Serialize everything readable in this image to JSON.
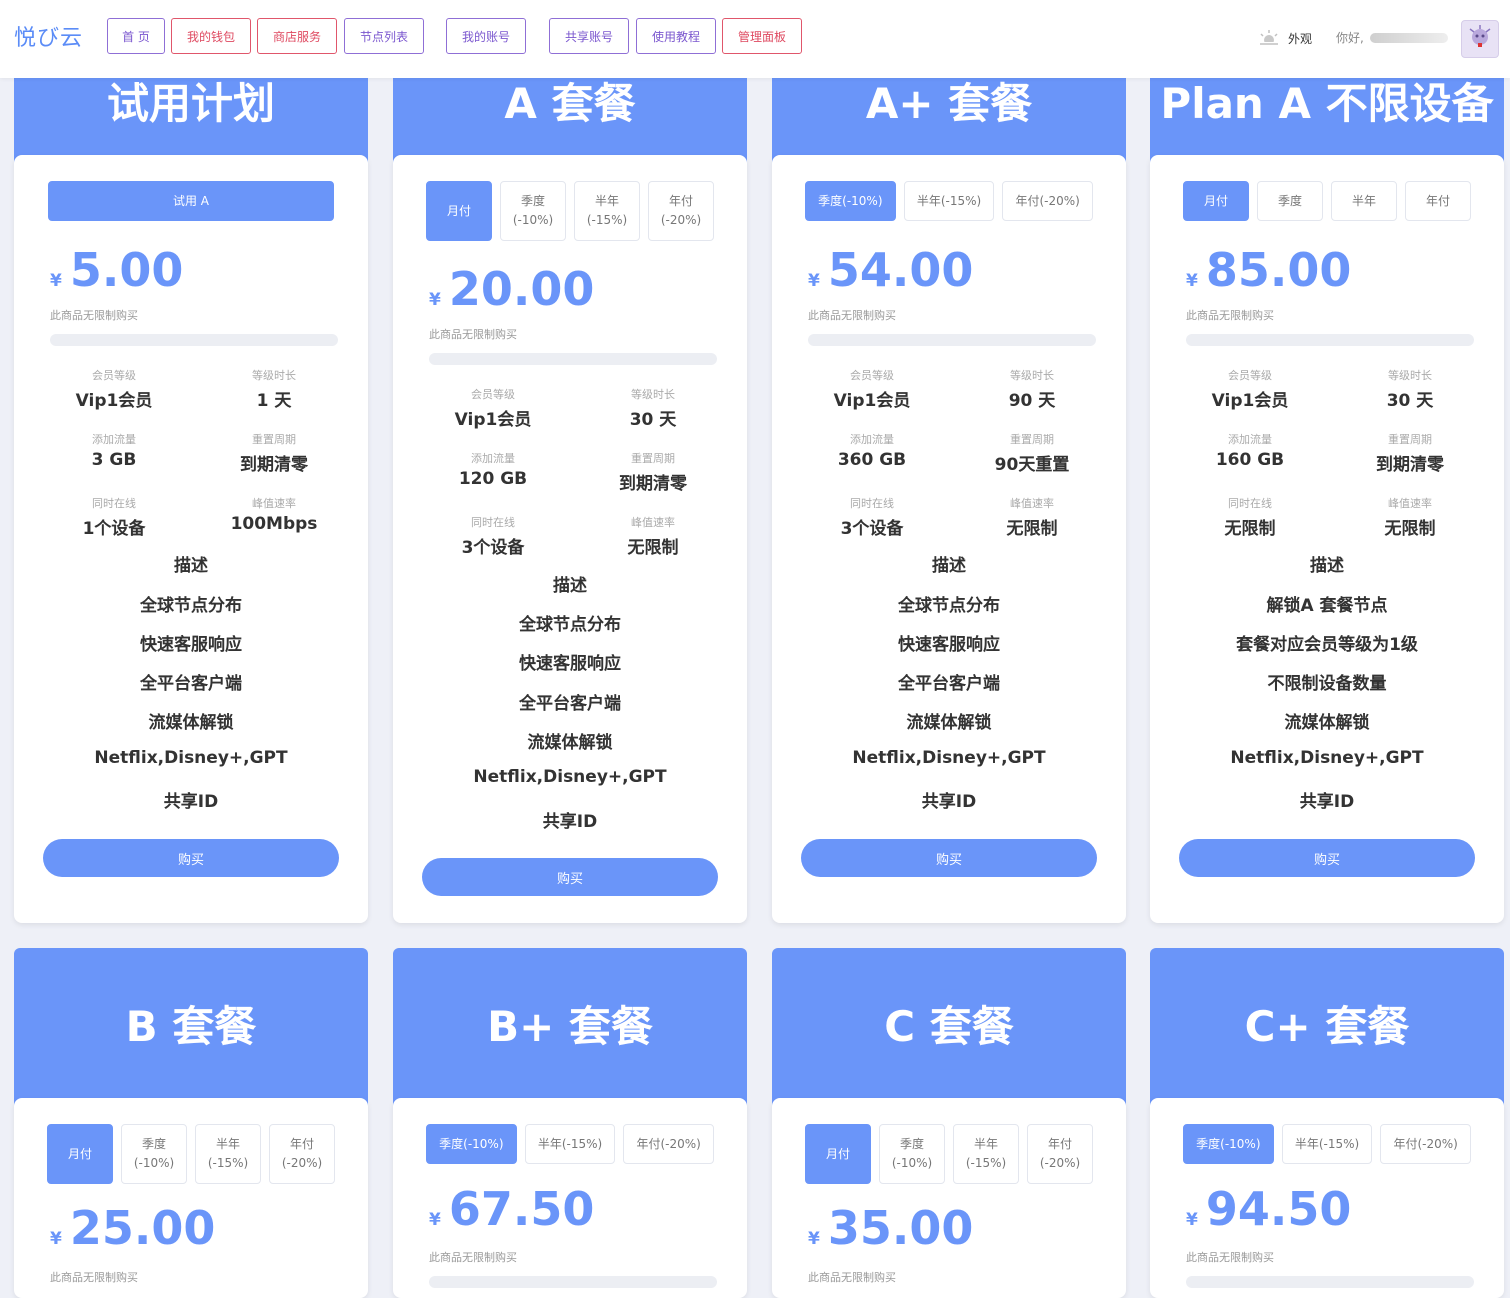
{
  "nav": {
    "brand": "悦び云",
    "items": [
      "首 页",
      "我的钱包",
      "商店服务",
      "节点列表",
      "我的账号",
      "共享账号",
      "使用教程",
      "管理面板"
    ],
    "appearance": "外观",
    "greeting": "你好,"
  },
  "plans": [
    {
      "name": "试用计划",
      "tabs": [
        {
          "l1": "试用 A",
          "l2": ""
        }
      ],
      "active_tab": 0,
      "currency": "¥",
      "price": "5.00",
      "note": "此商品无限制购买",
      "stats": [
        {
          "label": "会员等级",
          "value": "Vip1会员"
        },
        {
          "label": "等级时长",
          "value": "1 天"
        },
        {
          "label": "添加流量",
          "value": "3 GB"
        },
        {
          "label": "重置周期",
          "value": "到期清零"
        },
        {
          "label": "同时在线",
          "value": "1个设备"
        },
        {
          "label": "峰值速率",
          "value": "100Mbps"
        }
      ],
      "desc": [
        "描述",
        "全球节点分布",
        "快速客服响应",
        "全平台客户端",
        "流媒体解锁",
        "Netflix,Disney+,GPT",
        "共享ID"
      ],
      "buy": "购买"
    },
    {
      "name": "A 套餐",
      "tabs": [
        {
          "l1": "月付",
          "l2": ""
        },
        {
          "l1": "季度",
          "l2": "(-10%)"
        },
        {
          "l1": "半年",
          "l2": "(-15%)"
        },
        {
          "l1": "年付",
          "l2": "(-20%)"
        }
      ],
      "active_tab": 0,
      "currency": "¥",
      "price": "20.00",
      "note": "此商品无限制购买",
      "stats": [
        {
          "label": "会员等级",
          "value": "Vip1会员"
        },
        {
          "label": "等级时长",
          "value": "30 天"
        },
        {
          "label": "添加流量",
          "value": "120 GB"
        },
        {
          "label": "重置周期",
          "value": "到期清零"
        },
        {
          "label": "同时在线",
          "value": "3个设备"
        },
        {
          "label": "峰值速率",
          "value": "无限制"
        }
      ],
      "desc": [
        "描述",
        "全球节点分布",
        "快速客服响应",
        "全平台客户端",
        "流媒体解锁",
        "Netflix,Disney+,GPT",
        "共享ID"
      ],
      "buy": "购买"
    },
    {
      "name": "A+ 套餐",
      "tabs": [
        {
          "l1": "季度(-10%)",
          "l2": ""
        },
        {
          "l1": "半年(-15%)",
          "l2": ""
        },
        {
          "l1": "年付(-20%)",
          "l2": ""
        }
      ],
      "active_tab": 0,
      "currency": "¥",
      "price": "54.00",
      "note": "此商品无限制购买",
      "stats": [
        {
          "label": "会员等级",
          "value": "Vip1会员"
        },
        {
          "label": "等级时长",
          "value": "90 天"
        },
        {
          "label": "添加流量",
          "value": "360 GB"
        },
        {
          "label": "重置周期",
          "value": "90天重置"
        },
        {
          "label": "同时在线",
          "value": "3个设备"
        },
        {
          "label": "峰值速率",
          "value": "无限制"
        }
      ],
      "desc": [
        "描述",
        "全球节点分布",
        "快速客服响应",
        "全平台客户端",
        "流媒体解锁",
        "Netflix,Disney+,GPT",
        "共享ID"
      ],
      "buy": "购买"
    },
    {
      "name": "Plan A 不限设备",
      "tabs": [
        {
          "l1": "月付",
          "l2": ""
        },
        {
          "l1": "季度",
          "l2": ""
        },
        {
          "l1": "半年",
          "l2": ""
        },
        {
          "l1": "年付",
          "l2": ""
        }
      ],
      "active_tab": 0,
      "currency": "¥",
      "price": "85.00",
      "note": "此商品无限制购买",
      "stats": [
        {
          "label": "会员等级",
          "value": "Vip1会员"
        },
        {
          "label": "等级时长",
          "value": "30 天"
        },
        {
          "label": "添加流量",
          "value": "160 GB"
        },
        {
          "label": "重置周期",
          "value": "到期清零"
        },
        {
          "label": "同时在线",
          "value": "无限制"
        },
        {
          "label": "峰值速率",
          "value": "无限制"
        }
      ],
      "desc": [
        "描述",
        "解锁A 套餐节点",
        "套餐对应会员等级为1级",
        "不限制设备数量",
        "流媒体解锁",
        "Netflix,Disney+,GPT",
        "共享ID"
      ],
      "buy": "购买"
    },
    {
      "name": "B 套餐",
      "tabs": [
        {
          "l1": "月付",
          "l2": ""
        },
        {
          "l1": "季度",
          "l2": "(-10%)"
        },
        {
          "l1": "半年",
          "l2": "(-15%)"
        },
        {
          "l1": "年付",
          "l2": "(-20%)"
        }
      ],
      "active_tab": 0,
      "currency": "¥",
      "price": "25.00",
      "note": "此商品无限制购买"
    },
    {
      "name": "B+ 套餐",
      "tabs": [
        {
          "l1": "季度(-10%)",
          "l2": ""
        },
        {
          "l1": "半年(-15%)",
          "l2": ""
        },
        {
          "l1": "年付(-20%)",
          "l2": ""
        }
      ],
      "active_tab": 0,
      "currency": "¥",
      "price": "67.50",
      "note": "此商品无限制购买"
    },
    {
      "name": "C 套餐",
      "tabs": [
        {
          "l1": "月付",
          "l2": ""
        },
        {
          "l1": "季度",
          "l2": "(-10%)"
        },
        {
          "l1": "半年",
          "l2": "(-15%)"
        },
        {
          "l1": "年付",
          "l2": "(-20%)"
        }
      ],
      "active_tab": 0,
      "currency": "¥",
      "price": "35.00",
      "note": "此商品无限制购买"
    },
    {
      "name": "C+ 套餐",
      "tabs": [
        {
          "l1": "季度(-10%)",
          "l2": ""
        },
        {
          "l1": "半年(-15%)",
          "l2": ""
        },
        {
          "l1": "年付(-20%)",
          "l2": ""
        }
      ],
      "active_tab": 0,
      "currency": "¥",
      "price": "94.50",
      "note": "此商品无限制购买"
    }
  ],
  "colors": {
    "accent": "#6a95f9",
    "nav_purple": "#7b57cf",
    "nav_red": "#df4a61"
  }
}
